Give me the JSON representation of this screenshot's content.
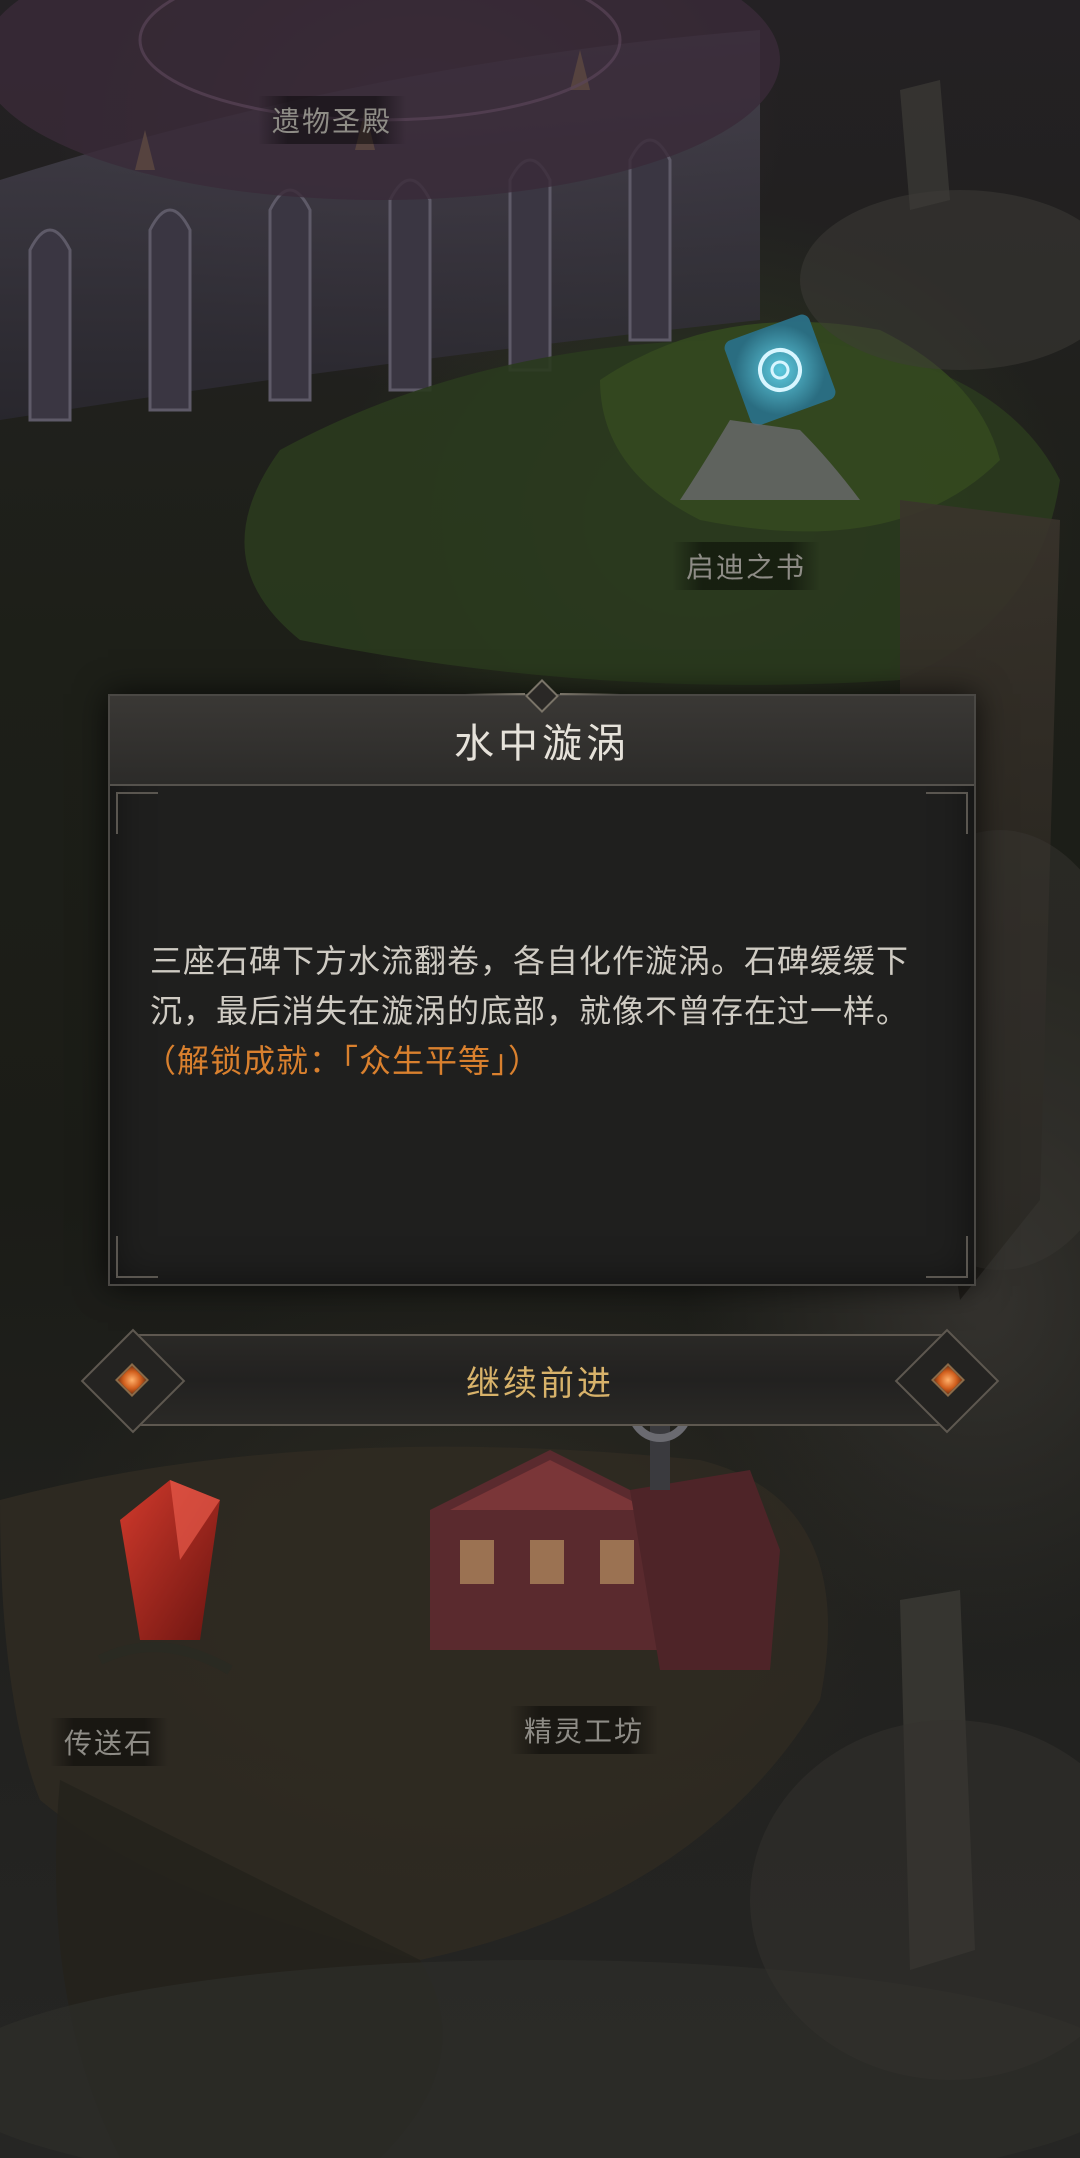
{
  "map": {
    "labels": {
      "relic_temple": "遗物圣殿",
      "book_of_kidi": "启迪之书",
      "teleport_stone": "传送石",
      "elf_workshop": "精灵工坊"
    }
  },
  "dialog": {
    "title": "水中漩涡",
    "body": "三座石碑下方水流翻卷，各自化作漩涡。石碑缓缓下沉，最后消失在漩涡的底部，就像不曾存在过一样。",
    "unlock": "（解锁成就：「众生平等」）",
    "unlock_color": "#d9802e"
  },
  "continue_button": {
    "label": "继续前进"
  }
}
